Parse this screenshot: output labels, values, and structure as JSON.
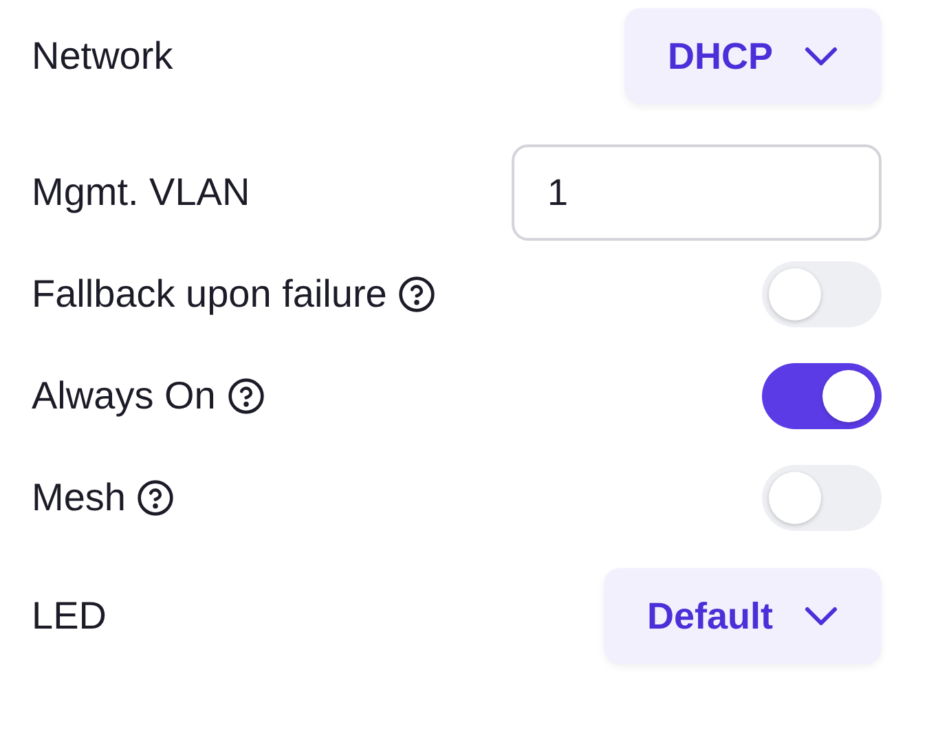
{
  "settings": [
    {
      "kind": "select",
      "label": "Network",
      "help": false,
      "value": "DHCP"
    },
    {
      "kind": "input",
      "label": "Mgmt. VLAN",
      "help": false,
      "value": "1"
    },
    {
      "kind": "toggle",
      "label": "Fallback upon failure",
      "help": true,
      "on": false
    },
    {
      "kind": "toggle",
      "label": "Always On",
      "help": true,
      "on": true
    },
    {
      "kind": "toggle",
      "label": "Mesh",
      "help": true,
      "on": false
    },
    {
      "kind": "select",
      "label": "LED",
      "help": false,
      "value": "Default"
    }
  ]
}
